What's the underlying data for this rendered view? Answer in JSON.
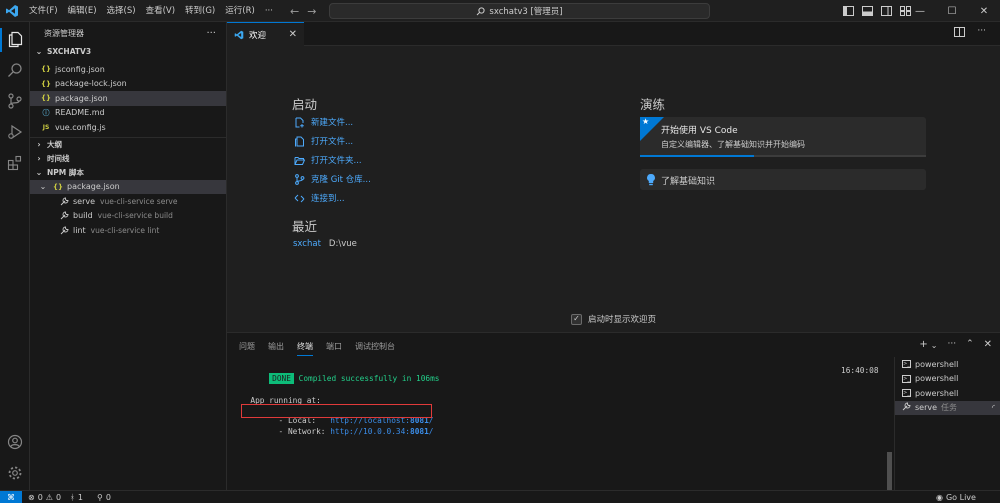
{
  "titlebar": {
    "menu": [
      "文件(F)",
      "编辑(E)",
      "选择(S)",
      "查看(V)",
      "转到(G)",
      "运行(R)",
      "···"
    ],
    "command_center": "sxchatv3 [管理员]"
  },
  "sidebar": {
    "title": "资源管理器",
    "more": "···",
    "workspace": "SXCHATV3",
    "files": [
      {
        "icon": "{}",
        "name": "jsconfig.json"
      },
      {
        "icon": "{}",
        "name": "package-lock.json"
      },
      {
        "icon": "{}",
        "name": "package.json"
      },
      {
        "icon": "ⓘ",
        "name": "README.md"
      },
      {
        "icon": "JS",
        "name": "vue.config.js"
      }
    ],
    "outline": "大纲",
    "timeline": "时间线",
    "npm": "NPM 脚本",
    "npm_package": "package.json",
    "scripts": [
      {
        "name": "serve",
        "cmd": "vue-cli-service serve"
      },
      {
        "name": "build",
        "cmd": "vue-cli-service build"
      },
      {
        "name": "lint",
        "cmd": "vue-cli-service lint"
      }
    ]
  },
  "tab": {
    "label": "欢迎",
    "close": "✕"
  },
  "welcome": {
    "start_title": "启动",
    "start_links": [
      "新建文件...",
      "打开文件...",
      "打开文件夹...",
      "克隆 Git 仓库...",
      "连接到..."
    ],
    "recent_title": "最近",
    "recent": {
      "name": "sxchat",
      "path": "D:\\vue"
    },
    "walkthrough_title": "演练",
    "card1_title": "开始使用 VS Code",
    "card1_desc": "自定义编辑器、了解基础知识并开始编码",
    "card1_progress": 0.4,
    "card2_title": "了解基础知识",
    "show_on_startup": "启动时显示欢迎页"
  },
  "panel": {
    "tabs": [
      "问题",
      "输出",
      "终端",
      "端口",
      "调试控制台"
    ],
    "active_tab": "终端",
    "terminal": {
      "done_badge": "DONE",
      "compiled": " Compiled successfully in 106ms",
      "time": "16:40:08",
      "app_running": "  App running at:",
      "local_prefix": "  - Local:   ",
      "local_url_base": "http://localhost:",
      "local_port": "8081",
      "local_slash": "/",
      "network_prefix": "  - Network: ",
      "network_url_base": "http://10.0.0.34:",
      "network_port": "8081",
      "network_slash": "/"
    },
    "terminals": [
      "powershell",
      "powershell",
      "powershell"
    ],
    "task": {
      "name": "serve",
      "label": "任务"
    }
  },
  "statusbar": {
    "remote": "⌘",
    "errors": "0",
    "warnings": "0",
    "info": "1",
    "ports": "0",
    "golive": "Go Live"
  }
}
